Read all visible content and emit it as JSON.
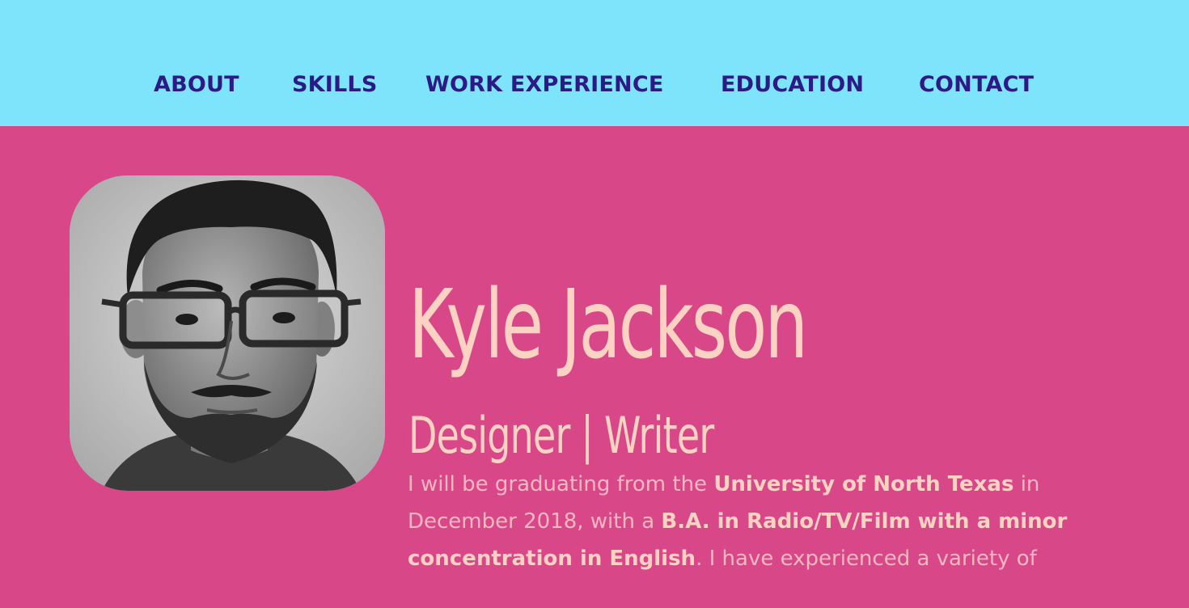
{
  "nav": {
    "items": [
      {
        "label": "ABOUT"
      },
      {
        "label": "SKILLS"
      },
      {
        "label": "WORK EXPERIENCE"
      },
      {
        "label": "EDUCATION"
      },
      {
        "label": "CONTACT"
      }
    ]
  },
  "hero": {
    "name": "Kyle Jackson",
    "role": "Designer | Writer",
    "bio": {
      "line1_a": "I will be graduating from the ",
      "line1_b": "University of North Texas",
      "line1_c": " in",
      "line2_a": "December 2018, with a ",
      "line2_b": "B.A. in Radio/TV/Film with a minor",
      "line3_a": "concentration in English",
      "line3_b": ". I have experienced a variety of"
    }
  },
  "colors": {
    "nav_bg": "#7de4fb",
    "nav_text": "#2c1a86",
    "page_bg": "#d84888",
    "heading_text": "#fcd2c2",
    "body_text": "#f7b7c0"
  },
  "icons": {
    "avatar": "profile-photo"
  }
}
